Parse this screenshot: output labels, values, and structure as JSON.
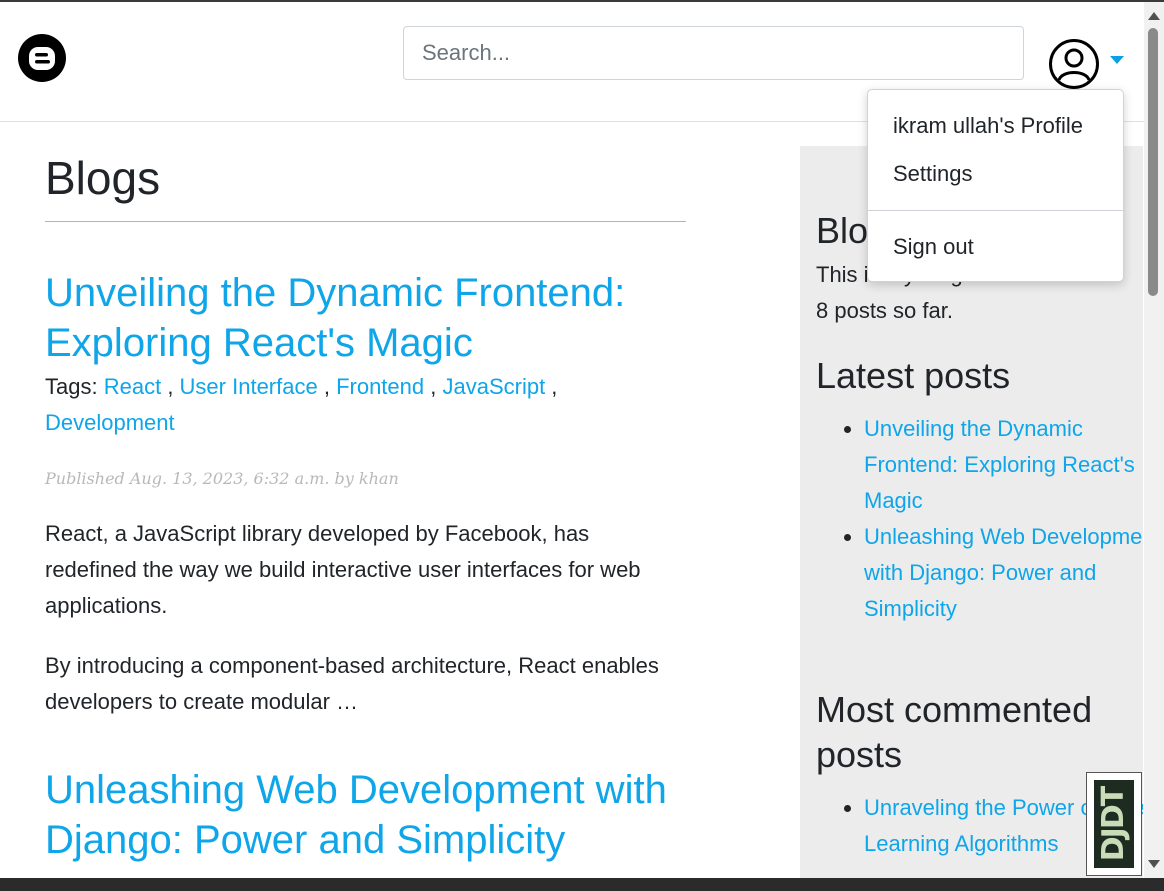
{
  "header": {
    "logo_icon": "blogger-logo-icon",
    "search_placeholder": "Search...",
    "avatar_icon": "user-circle-icon",
    "caret_icon": "caret-down-icon"
  },
  "user_menu": {
    "items": [
      {
        "label": "ikram ullah's Profile"
      },
      {
        "label": "Settings"
      },
      {
        "label": "Sign out"
      }
    ]
  },
  "main": {
    "title": "Blogs",
    "posts": [
      {
        "title": "Unveiling the Dynamic Frontend: Exploring React's Magic",
        "tags_label": "Tags:",
        "tags": [
          "React",
          "User Interface",
          "Frontend",
          "JavaScript",
          "Development"
        ],
        "published": "Published Aug. 13, 2023, 6:32 a.m. by khan",
        "paragraphs": [
          "React, a JavaScript library developed by Facebook, has redefined the way we build interactive user interfaces for web applications.",
          "By introducing a component-based architecture, React enables developers to create modular …"
        ]
      },
      {
        "title": "Unleashing Web Development with Django: Power and Simplicity"
      }
    ]
  },
  "sidebar": {
    "blog_heading": "Blog",
    "blog_text_line1": "This is my blog. I've written",
    "blog_text_line2": "8 posts so far.",
    "latest_heading": "Latest posts",
    "latest_posts": [
      "Unveiling the Dynamic Frontend: Exploring React's Magic",
      "Unleashing Web Development with Django: Power and Simplicity"
    ],
    "most_commented_heading": "Most commented posts",
    "most_commented_posts": [
      "Unraveling the Power of Deep Learning Algorithms"
    ]
  },
  "debug_toolbar": {
    "label": "DJDT"
  }
}
